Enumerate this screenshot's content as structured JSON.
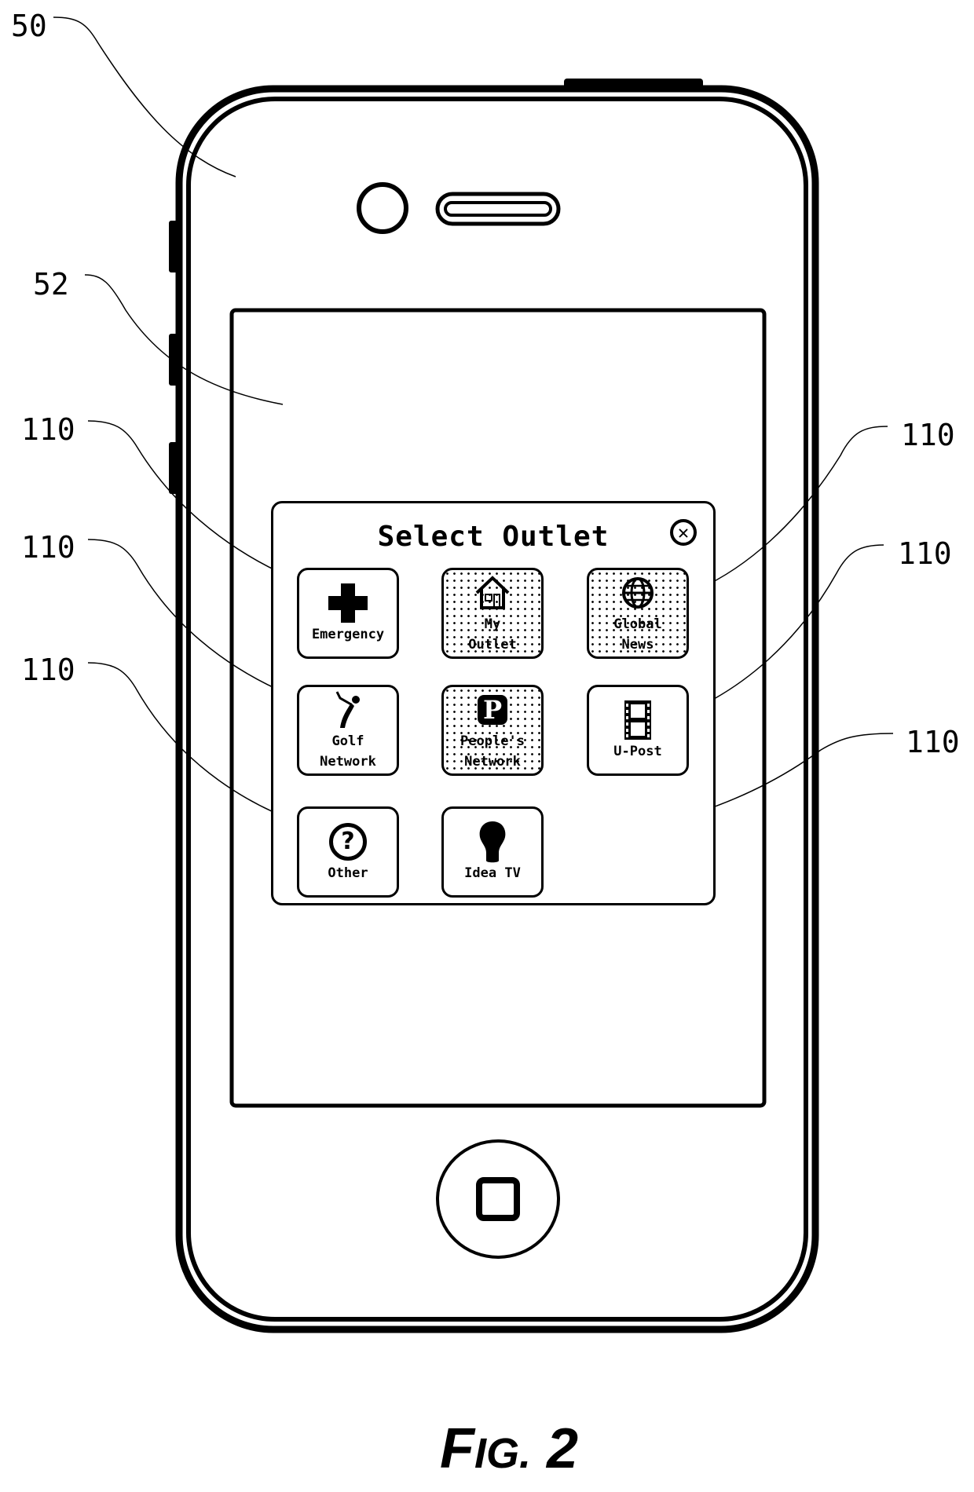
{
  "figure_label": {
    "prefix": "F",
    "small_caps": "IG.",
    "number": "2"
  },
  "reference_numerals": {
    "device": "50",
    "screen": "52",
    "outlet_buttons": [
      "110",
      "110",
      "110",
      "110",
      "110",
      "110"
    ]
  },
  "dialog": {
    "title": "Select Outlet",
    "close_icon": "close-circle-x",
    "close_glyph": "✕",
    "tiles": [
      {
        "label": "Emergency",
        "icon": "medical-cross-icon",
        "dotted": false
      },
      {
        "label": "My\nOutlet",
        "icon": "house-icon",
        "dotted": true
      },
      {
        "label": "Global\nNews",
        "icon": "globe-icon",
        "dotted": true
      },
      {
        "label": "Golf\nNetwork",
        "icon": "golfer-icon",
        "dotted": false
      },
      {
        "label": "People's\nNetwork",
        "icon": "p-badge-icon",
        "dotted": true,
        "glyph": "P"
      },
      {
        "label": "U-Post",
        "icon": "film-strip-icon",
        "dotted": false
      },
      {
        "label": "Other",
        "icon": "question-circle-icon",
        "dotted": false,
        "glyph": "?"
      },
      {
        "label": "Idea TV",
        "icon": "lightbulb-icon",
        "dotted": false
      }
    ]
  }
}
